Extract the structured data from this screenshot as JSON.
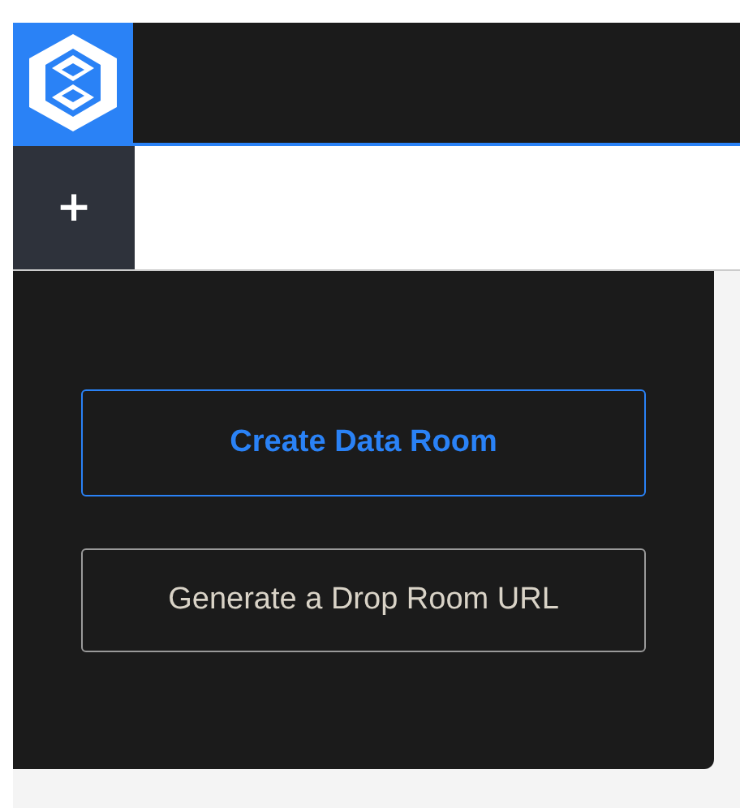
{
  "toolbar": {
    "add_symbol": "+"
  },
  "buttons": [
    {
      "label": "Create Data Room",
      "kind": "primary"
    },
    {
      "label": "Generate a Drop Room URL",
      "kind": "secondary"
    }
  ]
}
